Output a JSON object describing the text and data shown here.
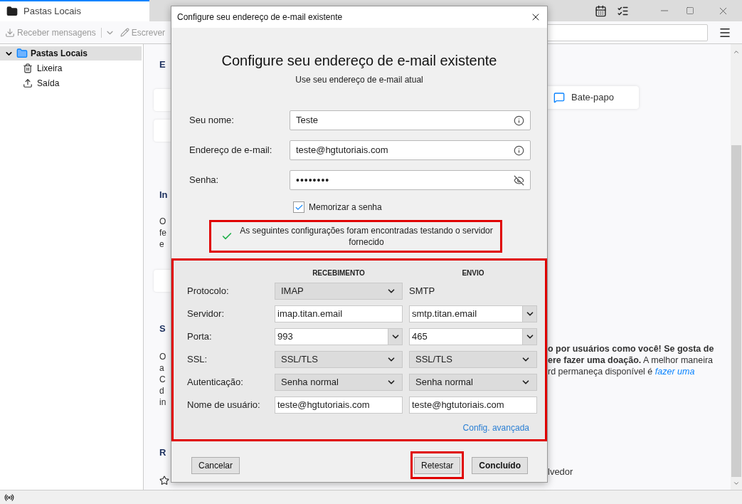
{
  "window": {
    "tab_title": "Pastas Locais"
  },
  "toolbar": {
    "buttons": [
      {
        "label": "Receber mensagens",
        "disabled": true,
        "has_menu": true
      },
      {
        "label": "Escrever",
        "disabled": true,
        "has_menu": false
      }
    ]
  },
  "sidebar": {
    "items": [
      {
        "label": "Pastas Locais",
        "selected": true,
        "expanded": true,
        "children": [
          {
            "label": "Lixeira",
            "kind": "trash",
            "selected": false
          },
          {
            "label": "Saída",
            "kind": "outbox",
            "selected": false
          }
        ]
      }
    ]
  },
  "background": {
    "left_fragments": [
      {
        "kind": "heading",
        "text": "E"
      },
      {
        "kind": "card"
      },
      {
        "kind": "card"
      },
      {
        "kind": "heading",
        "text": "In"
      },
      {
        "kind": "paragraph",
        "lines": [
          "O",
          "fe",
          "e"
        ]
      },
      {
        "kind": "card"
      },
      {
        "kind": "heading",
        "text": "S"
      },
      {
        "kind": "paragraph",
        "lines": [
          "O",
          "a",
          "C",
          "d",
          "in"
        ]
      },
      {
        "kind": "heading",
        "text": "R"
      },
      {
        "kind": "icon"
      }
    ],
    "chat_button": "Bate-papo",
    "donation_lines": [
      "**o por usuários como você! Se gosta de**",
      "**ere fazer uma doação.** A melhor maneira",
      "rd permaneça disponível é *fazer uma*"
    ],
    "footer_fragment": "lvedor"
  },
  "dialog": {
    "title": "Configure seu endereço de e-mail existente",
    "heading": "Configure seu endereço de e-mail existente",
    "subtitle": "Use seu endereço de e-mail atual",
    "fields": [
      {
        "label": "Seu nome:",
        "value": "Teste",
        "kind": "text"
      },
      {
        "label": "Endereço de e-mail:",
        "value": "teste@hgtutoriais.com",
        "kind": "text"
      },
      {
        "label": "Senha:",
        "value": "••••••••",
        "kind": "password"
      }
    ],
    "remember_password": {
      "label": "Memorizar a senha",
      "checked": true
    },
    "message": {
      "text": "As seguintes configurações foram encontradas testando o servidor fornecido",
      "highlighted": true
    },
    "server_settings": {
      "highlighted": true,
      "columns": [
        "RECEBIMENTO",
        "ENVIO"
      ],
      "rows": [
        {
          "label": "Protocolo:",
          "incoming": {
            "kind": "select",
            "value": "IMAP"
          },
          "outgoing": {
            "kind": "text",
            "value": "SMTP"
          }
        },
        {
          "label": "Servidor:",
          "incoming": {
            "kind": "input",
            "value": "imap.titan.email"
          },
          "outgoing": {
            "kind": "combo",
            "value": "smtp.titan.email"
          }
        },
        {
          "label": "Porta:",
          "incoming": {
            "kind": "combo",
            "value": "993"
          },
          "outgoing": {
            "kind": "combo",
            "value": "465"
          }
        },
        {
          "label": "SSL:",
          "incoming": {
            "kind": "select",
            "value": "SSL/TLS"
          },
          "outgoing": {
            "kind": "select",
            "value": "SSL/TLS"
          }
        },
        {
          "label": "Autenticação:",
          "incoming": {
            "kind": "select",
            "value": "Senha normal"
          },
          "outgoing": {
            "kind": "select",
            "value": "Senha normal"
          }
        },
        {
          "label": "Nome de usuário:",
          "incoming": {
            "kind": "input",
            "value": "teste@hgtutoriais.com"
          },
          "outgoing": {
            "kind": "input",
            "value": "teste@hgtutoriais.com"
          }
        }
      ],
      "advanced_link": "Config. avançada"
    },
    "buttons": [
      {
        "label": "Cancelar",
        "kind": "cancel",
        "highlighted": false
      },
      {
        "label": "Retestar",
        "kind": "retest",
        "highlighted": true
      },
      {
        "label": "Concluído",
        "kind": "done",
        "highlighted": false
      }
    ]
  }
}
